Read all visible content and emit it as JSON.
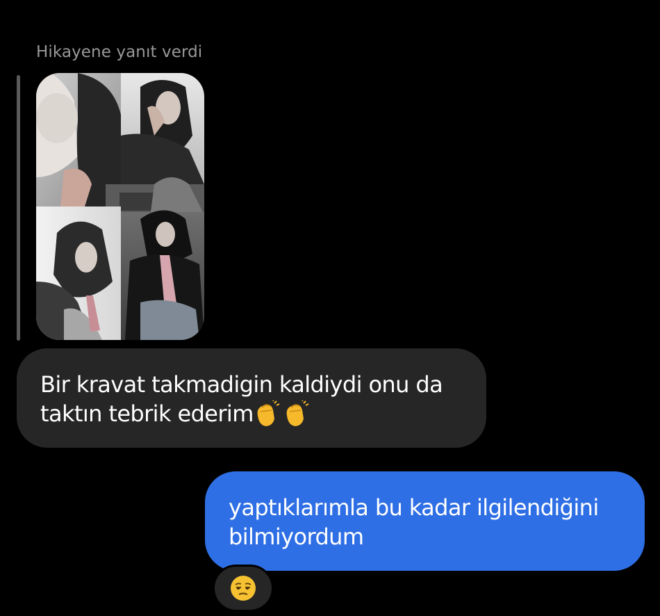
{
  "story_reply": {
    "label": "Hikayene yanıt verdi",
    "thumbnail_icon": "story-collage-photo"
  },
  "messages": [
    {
      "direction": "received",
      "line1": "Bir kravat takmadigin kaldiydi onu da",
      "line2": "taktın tebrik ederim",
      "emojis": "👏👏"
    },
    {
      "direction": "sent",
      "line1": "yaptıklarımla bu kadar ilgilendiğini",
      "line2": "bilmiyordum",
      "reaction_icon": "unamused-face-emoji"
    }
  ],
  "colors": {
    "background": "#000000",
    "received_bubble": "#262626",
    "sent_bubble": "#2f6fe5",
    "label_text": "#9a9a9a"
  }
}
